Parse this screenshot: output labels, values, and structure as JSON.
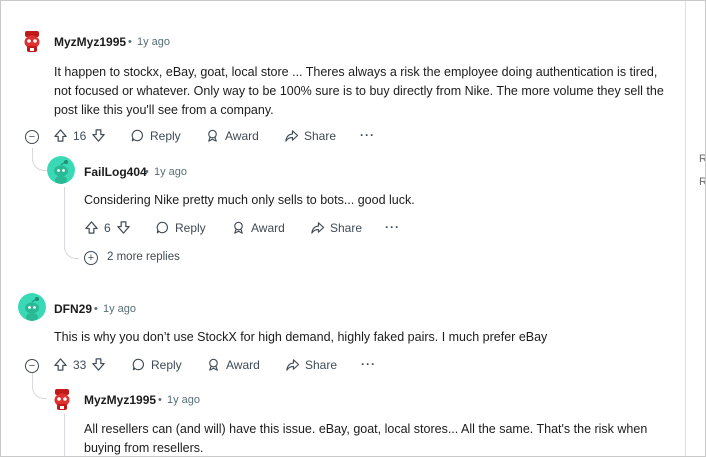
{
  "comments": [
    {
      "author": "MyzMyz1995",
      "age": "1y ago",
      "text": "It happen to stockx, eBay, goat, local store ... Theres always a risk the employee doing authentication is tired, not focused or whatever. Only way to be 100% sure is to buy directly from Nike. The more volume they sell the post like this you'll see from a company.",
      "votes": "16",
      "reply_label": "Reply",
      "award_label": "Award",
      "share_label": "Share",
      "more_label": "···"
    },
    {
      "author": "FailLog404",
      "age": "1y ago",
      "text": "Considering Nike pretty much only sells to bots... good luck.",
      "votes": "6",
      "reply_label": "Reply",
      "award_label": "Award",
      "share_label": "Share",
      "more_label": "···",
      "more_replies": "2 more replies"
    },
    {
      "author": "DFN29",
      "age": "1y ago",
      "text": "This is why you don’t use StockX for high demand, highly faked pairs. I much prefer eBay",
      "votes": "33",
      "reply_label": "Reply",
      "award_label": "Award",
      "share_label": "Share",
      "more_label": "···"
    },
    {
      "author": "MyzMyz1995",
      "age": "1y ago",
      "text": "All resellers can (and will) have this issue. eBay, goat, local stores... All the same. That's the risk when buying from resellers."
    }
  ],
  "separator": "•",
  "rail_chars": [
    "R",
    "R"
  ],
  "colors": {
    "avatar_red": "#d93a3a",
    "avatar_green": "#38d9b4",
    "thread_line": "#d7dadc"
  },
  "icons": [
    "upvote-icon",
    "downvote-icon",
    "reply-icon",
    "award-icon",
    "share-icon",
    "collapse-icon",
    "expand-icon"
  ]
}
